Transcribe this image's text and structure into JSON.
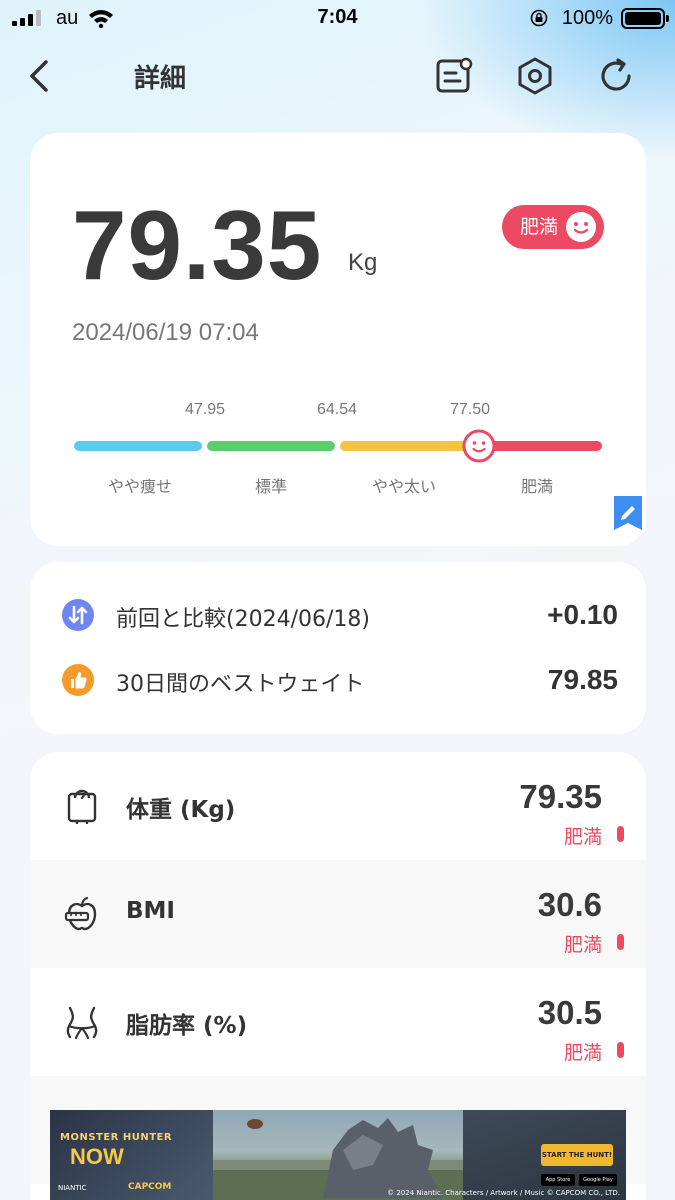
{
  "status_bar": {
    "carrier": "au",
    "time": "7:04",
    "battery_pct": "100%"
  },
  "header": {
    "title": "詳細",
    "icons": [
      "back-arrow-icon",
      "note-icon",
      "hexagon-settings-icon",
      "refresh-icon"
    ]
  },
  "summary": {
    "weight": "79.35",
    "unit": "Kg",
    "status": "肥満",
    "status_color": "#ec4a63",
    "datetime": "2024/06/19 07:04",
    "scale": {
      "thresholds": [
        "47.95",
        "64.54",
        "77.50"
      ],
      "categories": [
        "やや痩せ",
        "標準",
        "やや太い",
        "肥満"
      ],
      "colors": [
        "#5bc8ec",
        "#5ccd6a",
        "#f2c440",
        "#ec4a63"
      ]
    }
  },
  "comparison": {
    "items": [
      {
        "label": "前回と比較(2024/06/18)",
        "value": "+0.10",
        "icon": "compare-arrows-icon"
      },
      {
        "label": "30日間のベストウェイト",
        "value": "79.85",
        "icon": "thumbs-up-icon"
      }
    ]
  },
  "metrics": [
    {
      "label": "体重 (Kg)",
      "value": "79.35",
      "status": "肥満",
      "icon": "scale-icon"
    },
    {
      "label": "BMI",
      "value": "30.6",
      "status": "肥満",
      "icon": "apple-tape-icon"
    },
    {
      "label": "脂肪率 (%)",
      "value": "30.5",
      "status": "肥満",
      "icon": "waist-icon"
    }
  ],
  "ad": {
    "brand_top": "MONSTER HUNTER",
    "brand_main": "NOW",
    "niantic": "NIANTIC",
    "capcom": "CAPCOM",
    "cta": "START THE HUNT!",
    "store_apple": "App Store",
    "store_google": "Google Play",
    "copyright": "© 2024 Niantic. Characters / Artwork / Music © CAPCOM CO., LTD."
  }
}
